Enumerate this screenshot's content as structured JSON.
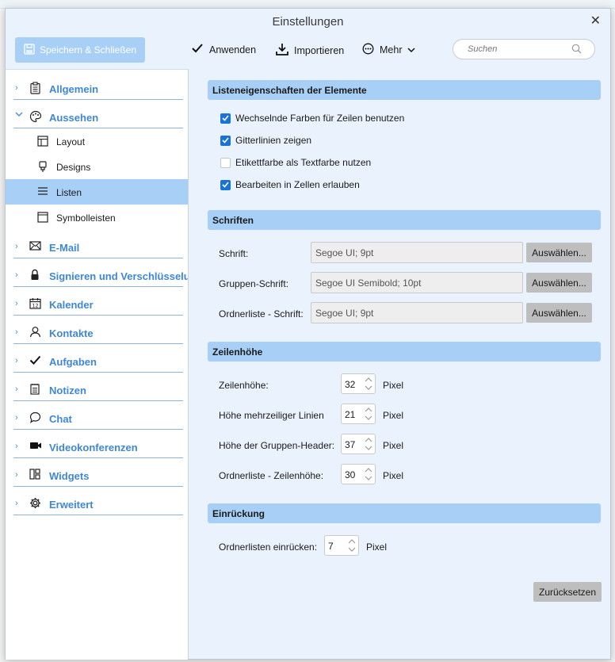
{
  "dialog": {
    "title": "Einstellungen",
    "close_label": "✕"
  },
  "toolbar": {
    "save_close_label": "Speichern & Schließen",
    "apply_label": "Anwenden",
    "import_label": "Importieren",
    "more_label": "Mehr",
    "search_placeholder": "Suchen"
  },
  "sidebar": {
    "items": [
      {
        "label": "Allgemein",
        "icon": "clipboard-icon",
        "expanded": false
      },
      {
        "label": "Aussehen",
        "icon": "palette-icon",
        "expanded": true,
        "children": [
          {
            "label": "Layout",
            "icon": "layout-icon"
          },
          {
            "label": "Designs",
            "icon": "brush-icon"
          },
          {
            "label": "Listen",
            "icon": "list-icon",
            "selected": true
          },
          {
            "label": "Symbolleisten",
            "icon": "toolbar-icon"
          }
        ]
      },
      {
        "label": "E-Mail",
        "icon": "mail-icon"
      },
      {
        "label": "Signieren und Verschlüsselu",
        "icon": "lock-icon"
      },
      {
        "label": "Kalender",
        "icon": "calendar-icon"
      },
      {
        "label": "Kontakte",
        "icon": "person-icon"
      },
      {
        "label": "Aufgaben",
        "icon": "check-icon"
      },
      {
        "label": "Notizen",
        "icon": "notepad-icon"
      },
      {
        "label": "Chat",
        "icon": "chat-bubble-icon"
      },
      {
        "label": "Videokonferenzen",
        "icon": "video-camera-icon"
      },
      {
        "label": "Widgets",
        "icon": "widgets-icon"
      },
      {
        "label": "Erweitert",
        "icon": "gear-icon"
      }
    ]
  },
  "content": {
    "list_props": {
      "title": "Listeneigenschaften der Elemente",
      "options": [
        {
          "label": "Wechselnde Farben für Zeilen benutzen",
          "checked": true
        },
        {
          "label": "Gitterlinien zeigen",
          "checked": true
        },
        {
          "label": "Etikettfarbe als Textfarbe nutzen",
          "checked": false
        },
        {
          "label": "Bearbeiten in Zellen erlauben",
          "checked": true
        }
      ]
    },
    "fonts": {
      "title": "Schriften",
      "rows": [
        {
          "label": "Schrift:",
          "value": "Segoe UI; 9pt",
          "button": "Auswählen..."
        },
        {
          "label": "Gruppen-Schrift:",
          "value": "Segoe UI Semibold; 10pt",
          "button": "Auswählen..."
        },
        {
          "label": "Ordnerliste - Schrift:",
          "value": "Segoe UI; 9pt",
          "button": "Auswählen..."
        }
      ]
    },
    "row_height": {
      "title": "Zeilenhöhe",
      "unit": "Pixel",
      "rows": [
        {
          "label": "Zeilenhöhe:",
          "value": "32"
        },
        {
          "label": "Höhe mehrzeiliger Linien",
          "value": "21"
        },
        {
          "label": "Höhe der Gruppen-Header:",
          "value": "37"
        },
        {
          "label": "Ordnerliste - Zeilenhöhe:",
          "value": "30"
        }
      ]
    },
    "indent": {
      "title": "Einrückung",
      "label": "Ordnerlisten einrücken:",
      "value": "7",
      "unit": "Pixel"
    },
    "reset_label": "Zurücksetzen"
  },
  "colors": {
    "accent": "#a8d0f7",
    "link": "#3f87d4",
    "checkbox": "#1a73d9",
    "panel_bg": "#eaf3fd"
  }
}
